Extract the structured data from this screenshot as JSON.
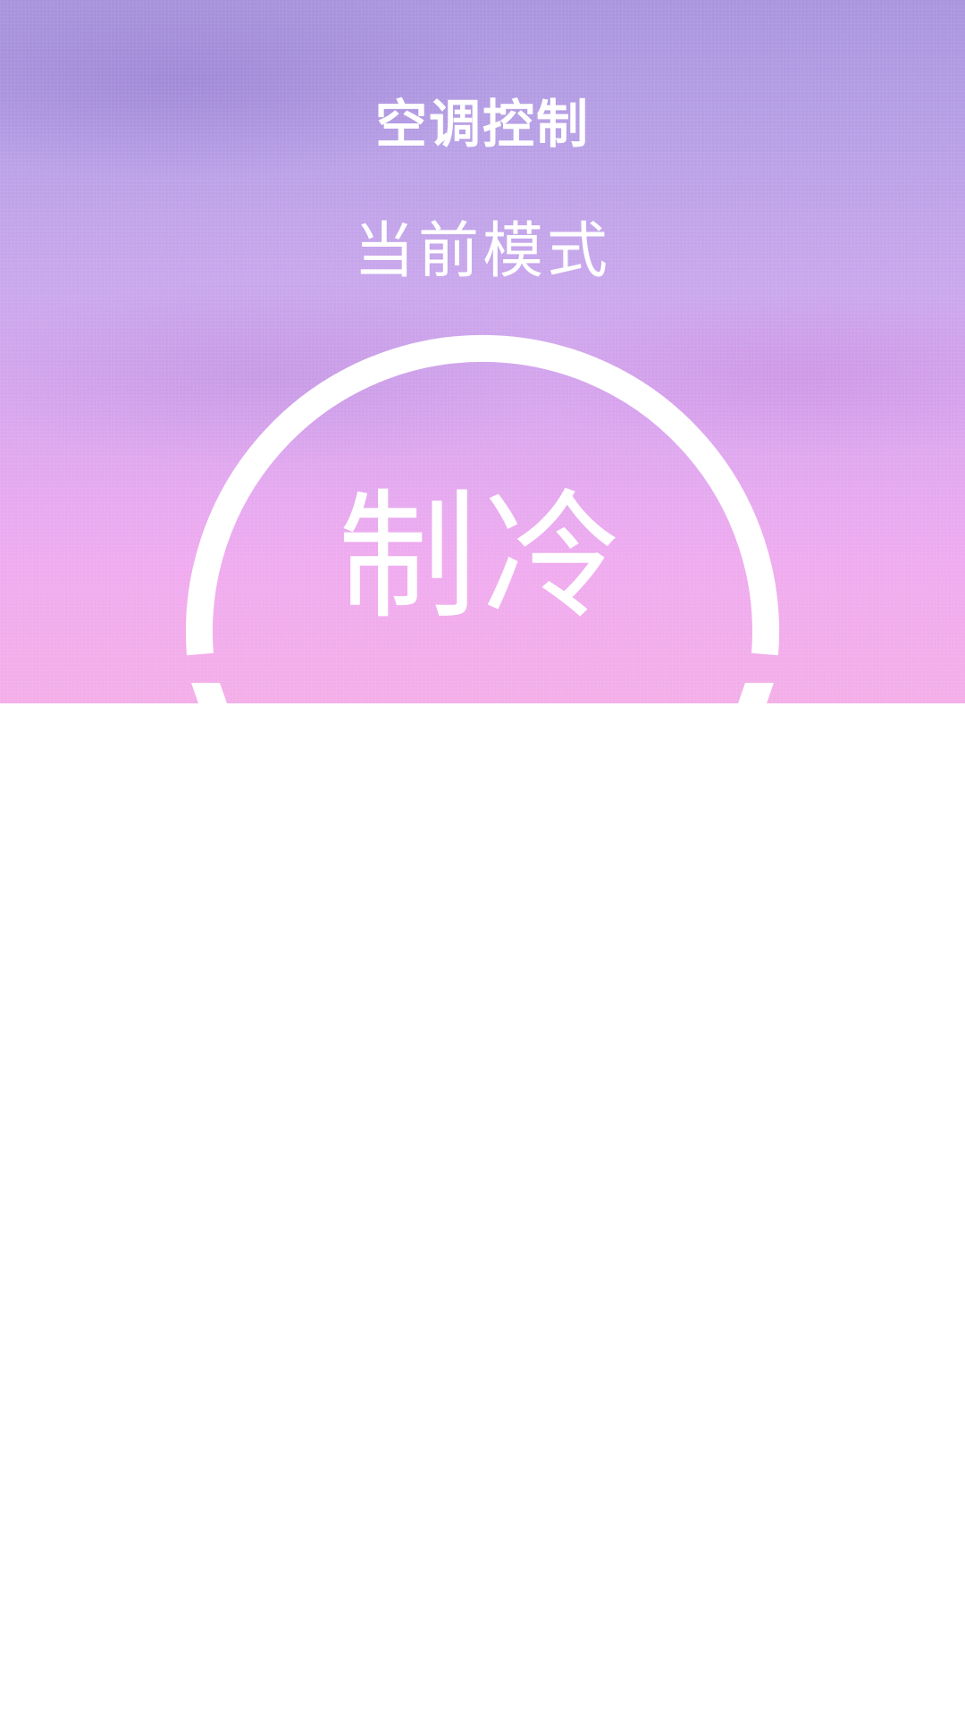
{
  "header": {
    "title": "空调控制"
  },
  "mode_panel": {
    "label": "当前模式",
    "value": "制冷"
  }
}
